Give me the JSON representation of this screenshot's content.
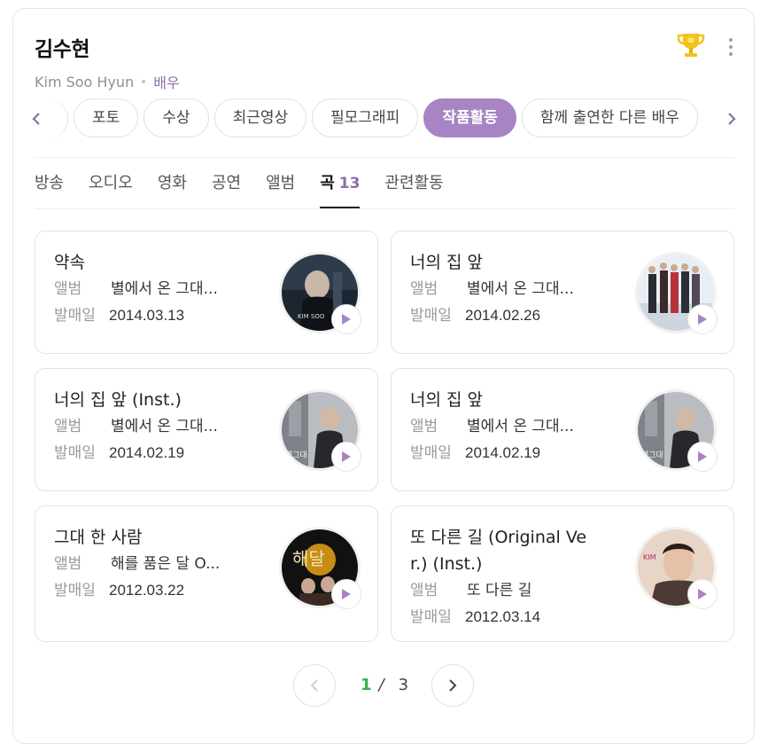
{
  "header": {
    "name": "김수현",
    "english_name": "Kim Soo Hyun",
    "occupation": "배우"
  },
  "icons": {
    "award": "trophy-icon",
    "more": "more-vertical-icon"
  },
  "chips": [
    "포토",
    "수상",
    "최근영상",
    "필모그래피",
    "작품활동",
    "함께 출연한 다른 배우"
  ],
  "active_chip": "작품활동",
  "tabs": [
    "방송",
    "오디오",
    "영화",
    "공연",
    "앨범",
    "곡",
    "관련활동"
  ],
  "active_tab": {
    "label": "곡",
    "count": "13"
  },
  "field_labels": {
    "album": "앨범",
    "release": "발매일"
  },
  "songs": [
    {
      "title": "약속",
      "album": "별에서 온 그대...",
      "date": "2014.03.13"
    },
    {
      "title": "너의 집 앞",
      "album": "별에서 온 그대...",
      "date": "2014.02.26"
    },
    {
      "title": "너의 집 앞 (Inst.)",
      "album": "별에서 온 그대...",
      "date": "2014.02.19"
    },
    {
      "title": "너의 집 앞",
      "album": "별에서 온 그대...",
      "date": "2014.02.19"
    },
    {
      "title": "그대 한 사람",
      "album": "해를 품은 달 O...",
      "date": "2012.03.22"
    },
    {
      "title": "또 다른 길 (Original Ver.) (Inst.)",
      "album": "또 다른 길",
      "date": "2012.03.14"
    }
  ],
  "pagination": {
    "current": "1",
    "separator": "/",
    "total": "3"
  },
  "colors": {
    "accent": "#a884c4",
    "current_page": "#2bb34e",
    "play": "#a884c4"
  }
}
